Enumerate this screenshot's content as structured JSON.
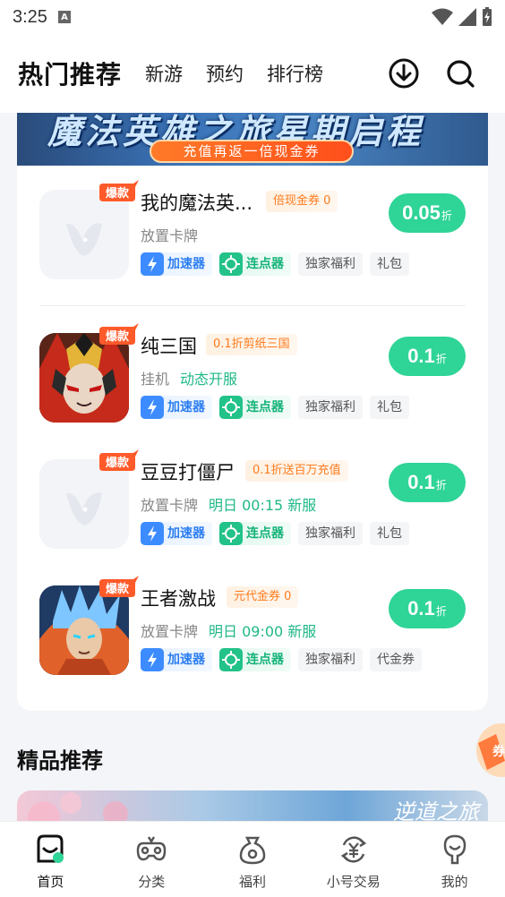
{
  "status_bar": {
    "time": "3:25"
  },
  "header": {
    "title": "热门推荐",
    "tabs": [
      "新游",
      "预约",
      "排行榜"
    ]
  },
  "banner": {
    "title": "魔法英雄之旅星期启程",
    "pill": "充值再返一倍现金券"
  },
  "hot_badge": "爆款",
  "games": [
    {
      "name": "我的魔法英...",
      "promo": "倍现金券      0",
      "meta": "放置卡牌",
      "meta_extra": "",
      "tags": [
        "加速器",
        "连点器",
        "独家福利",
        "礼包"
      ],
      "discount": "0.05",
      "discount_unit": "折",
      "icon": "placeholder-logo-icon"
    },
    {
      "name": "纯三国",
      "promo": "0.1折剪纸三国",
      "meta": "挂机",
      "meta_extra": "动态开服",
      "tags": [
        "加速器",
        "连点器",
        "独家福利",
        "礼包"
      ],
      "discount": "0.1",
      "discount_unit": "折",
      "icon": "warrior-portrait-icon"
    },
    {
      "name": "豆豆打僵尸",
      "promo": "0.1折送百万充值",
      "meta": "放置卡牌",
      "meta_extra": "明日 00:15 新服",
      "tags": [
        "加速器",
        "连点器",
        "独家福利",
        "礼包"
      ],
      "discount": "0.1",
      "discount_unit": "折",
      "icon": "placeholder-logo-icon"
    },
    {
      "name": "王者激战",
      "promo": "元代金券      0",
      "meta": "放置卡牌",
      "meta_extra": "明日 09:00 新服",
      "tags": [
        "加速器",
        "连点器",
        "独家福利",
        "代金券"
      ],
      "discount": "0.1",
      "discount_unit": "折",
      "icon": "saiyan-portrait-icon"
    }
  ],
  "section2_title": "精品推荐",
  "banner2_text": "逆道之旅",
  "bottom_nav": [
    {
      "label": "首页",
      "icon": "home-icon",
      "active": true
    },
    {
      "label": "分类",
      "icon": "gamepad-icon",
      "active": false
    },
    {
      "label": "福利",
      "icon": "gift-bag-icon",
      "active": false
    },
    {
      "label": "小号交易",
      "icon": "yuan-exchange-icon",
      "active": false
    },
    {
      "label": "我的",
      "icon": "profile-icon",
      "active": false
    }
  ],
  "colors": {
    "accent_green": "#2fd497",
    "promo_orange": "#ff7b1d",
    "tag_blue": "#2b7ef0",
    "tag_green": "#16b37a"
  }
}
